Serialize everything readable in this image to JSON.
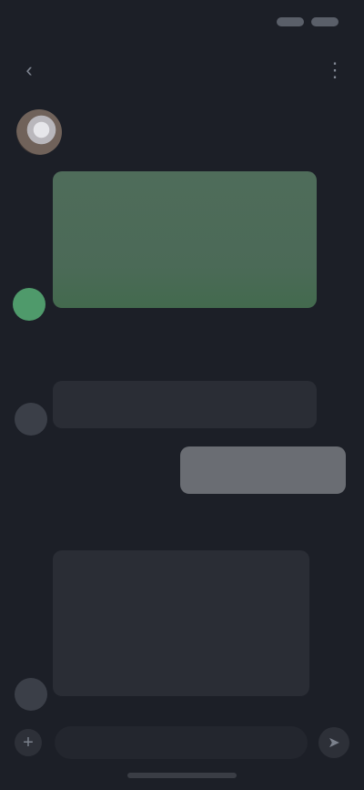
{
  "status_bar": {
    "time": "",
    "right": ""
  },
  "header": {
    "title": "",
    "back_icon": "back-arrow-icon",
    "menu_icon": "more-icon"
  },
  "conversation": {
    "sender_name": "",
    "messages": [
      {
        "id": "m1",
        "from": "other",
        "style": "green",
        "lines": [
          "",
          "",
          ""
        ],
        "link": ""
      },
      {
        "id": "m2",
        "from": "other",
        "style": "dark",
        "lines": [
          "",
          ""
        ]
      },
      {
        "id": "m3",
        "from": "me",
        "style": "outgoing",
        "lines": [
          ""
        ]
      },
      {
        "id": "m4",
        "from": "other",
        "style": "dark",
        "lines": [
          "",
          "",
          "",
          ""
        ]
      }
    ],
    "time_dividers": [
      "",
      ""
    ]
  },
  "compose": {
    "placeholder": "",
    "plus_icon": "plus-icon",
    "send_icon": "send-icon"
  },
  "colors": {
    "background": "#1c1f27",
    "incoming_green": "#4f6c5a",
    "incoming_dark": "#2a2d35",
    "outgoing": "#6a6d73"
  }
}
